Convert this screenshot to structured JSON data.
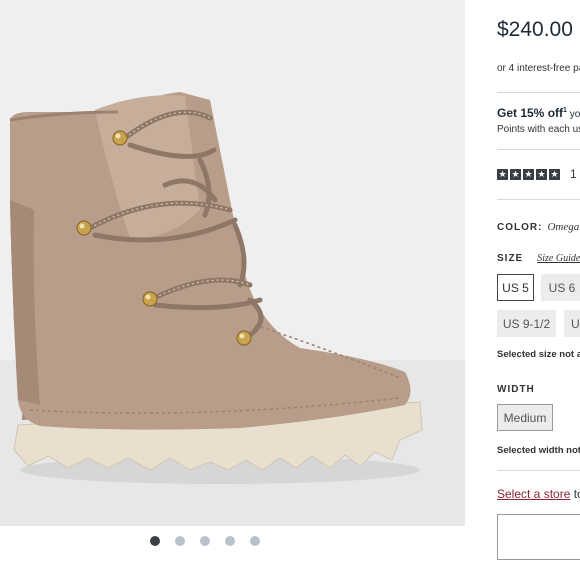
{
  "product": {
    "price": "$240.00",
    "installments": "or 4 interest-free pa",
    "promo_bold": "Get 15% off",
    "promo_sup": "1",
    "promo_rest": " you",
    "points_text": "Points with each use",
    "rating": {
      "stars": 5,
      "reviews_count": "1"
    },
    "color": {
      "label": "COLOR:",
      "value": "Omega"
    },
    "size": {
      "label": "SIZE",
      "guide_label": "Size Guide",
      "options": [
        {
          "label": "US 5",
          "state": "selected"
        },
        {
          "label": "US 6",
          "state": "unavailable"
        },
        {
          "label": "US 9-1/2",
          "state": "unavailable"
        },
        {
          "label": "U",
          "state": "unavailable"
        }
      ],
      "note": "Selected size not ava"
    },
    "width": {
      "label": "WIDTH",
      "options": [
        {
          "label": "Medium",
          "state": "unavailable"
        }
      ],
      "note": "Selected width not"
    },
    "store": {
      "link_label": "Select a store",
      "suffix": " to v"
    }
  },
  "gallery": {
    "image": "suede-lace-up-wedge-boot",
    "slide_count": 5,
    "active_slide": 1
  },
  "colors": {
    "link": "#8a2432",
    "suede": "#b89e8a",
    "sole": "#e9dfcf",
    "dot_active": "#3b4047",
    "dot_inactive": "#b8c2cc"
  }
}
